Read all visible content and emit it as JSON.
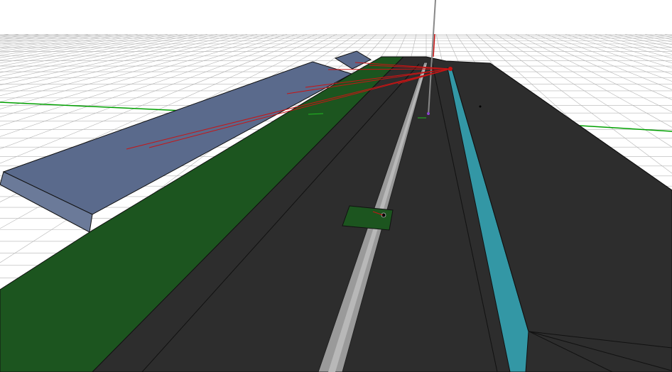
{
  "scene": {
    "type": "3d-viewport",
    "projection": "perspective",
    "background": "#ffffff",
    "ground_grid": {
      "visible": true,
      "color": "#b4b4b4"
    },
    "world_axes": {
      "x_axis_color": "#00a000",
      "z_axis_color": "#888888"
    },
    "objects": [
      {
        "name": "sidewalk-left",
        "color": "#5a6a8c"
      },
      {
        "name": "grass-verge-left",
        "color": "#1c551f"
      },
      {
        "name": "road-surface",
        "color": "#2d2d2d"
      },
      {
        "name": "median-rail",
        "color": "#9a9a9a"
      },
      {
        "name": "curb-right",
        "color": "#3397a5"
      },
      {
        "name": "grass-patch-marker",
        "color": "#1c551f"
      }
    ],
    "sensor_rays": {
      "color": "#c81414",
      "count": 9
    }
  }
}
